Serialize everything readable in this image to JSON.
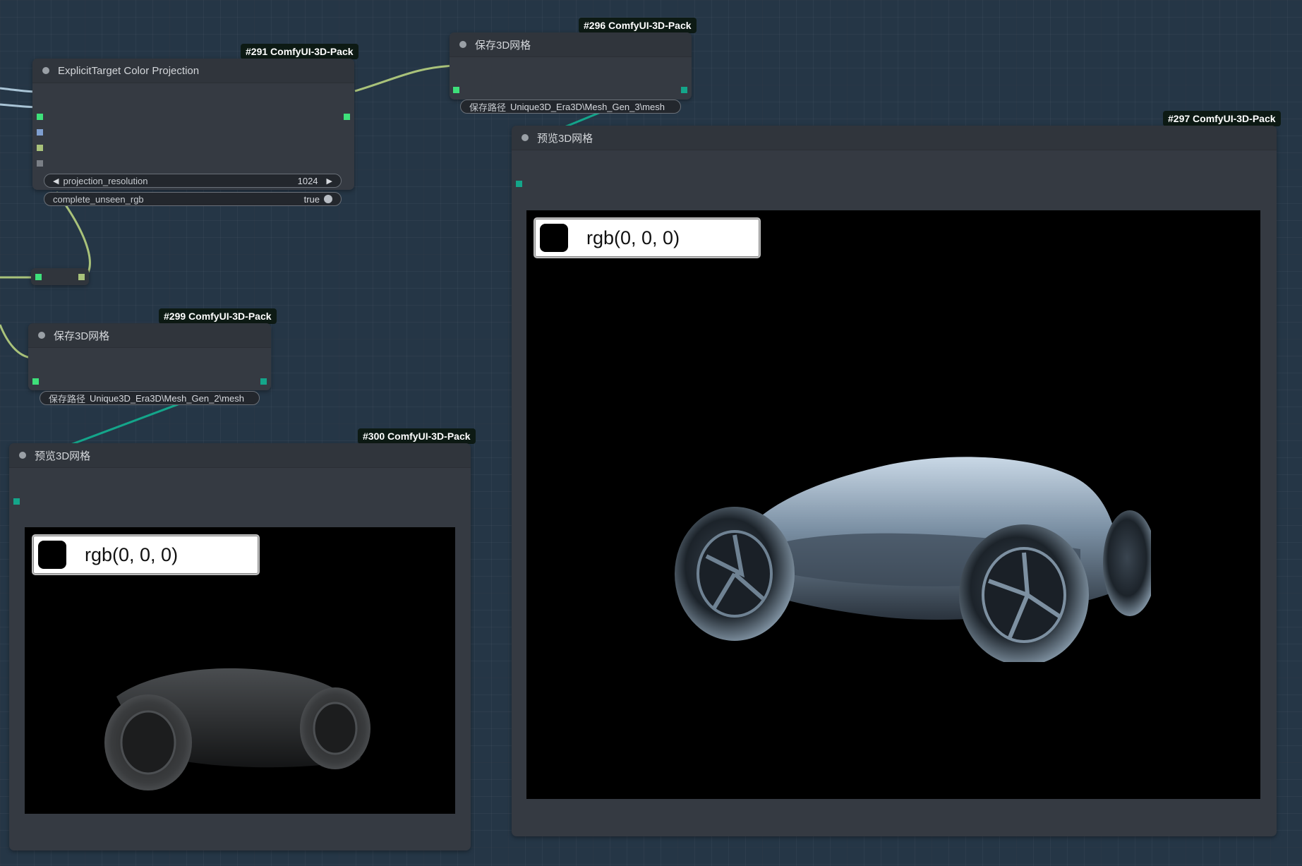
{
  "nodes": {
    "n291": {
      "badge": "#291 ComfyUI-3D-Pack",
      "title": "ExplicitTarget Color Projection",
      "widgets": [
        {
          "label": "projection_resolution",
          "value": "1024"
        },
        {
          "label": "complete_unseen_rgb",
          "value": "true"
        }
      ]
    },
    "n296": {
      "badge": "#296 ComfyUI-3D-Pack",
      "title": "保存3D网格",
      "path_label": "保存路径",
      "path_value": "Unique3D_Era3D\\Mesh_Gen_3\\mesh"
    },
    "n299": {
      "badge": "#299 ComfyUI-3D-Pack",
      "title": "保存3D网格",
      "path_label": "保存路径",
      "path_value": "Unique3D_Era3D\\Mesh_Gen_2\\mesh"
    },
    "n297": {
      "badge": "#297 ComfyUI-3D-Pack",
      "title": "预览3D网格",
      "bg_color_text": "rgb(0, 0, 0)"
    },
    "n300": {
      "badge": "#300 ComfyUI-3D-Pack",
      "title": "预览3D网格",
      "bg_color_text": "rgb(0, 0, 0)"
    }
  },
  "colors": {
    "canvas_bg": "#253646",
    "node_bg": "#353a42",
    "link_green": "#a9c27a",
    "link_teal": "#14a58a",
    "slot_green": "#3ee07a"
  }
}
